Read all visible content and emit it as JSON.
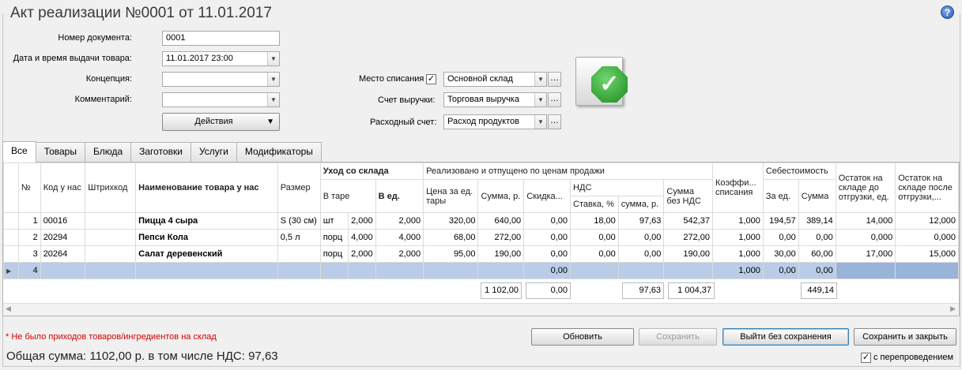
{
  "title": "Акт реализации №0001 от 11.01.2017",
  "form": {
    "doc_number_label": "Номер документа:",
    "doc_number": "0001",
    "date_label": "Дата и время выдачи товара:",
    "date": "11.01.2017 23:00",
    "concept_label": "Концепция:",
    "concept": "",
    "comment_label": "Комментарий:",
    "comment": "",
    "actions_label": "Действия",
    "writeoff_place_label": "Место списания",
    "writeoff_place": "Основной склад",
    "revenue_account_label": "Счет выручки:",
    "revenue_account": "Торговая выручка",
    "expense_account_label": "Расходный счет:",
    "expense_account": "Расход продуктов"
  },
  "tabs": [
    "Все",
    "Товары",
    "Блюда",
    "Заготовки",
    "Услуги",
    "Модификаторы"
  ],
  "table": {
    "headers": {
      "num": "№",
      "code": "Код у нас",
      "barcode": "Штрихкод",
      "name": "Наименование товара у нас",
      "size": "Размер",
      "out": "Уход со склада",
      "in_tare": "В таре",
      "in_units": "В ед.",
      "sold": "Реализовано и отпущено по ценам продажи",
      "price": "Цена за ед. тары",
      "amount": "Сумма, р.",
      "discount": "Скидка...",
      "vat": "НДС",
      "vat_rate": "Ставка, %",
      "vat_sum": "сумма, р.",
      "sum_no_vat": "Сумма без НДС",
      "coef": "Коэффи... списания",
      "cost": "Себестоимость",
      "cost_unit": "За ед.",
      "cost_sum": "Сумма",
      "stock_before": "Остаток на складе до отгрузки, ед.",
      "stock_after": "Остаток на складе после отгрузки,..."
    },
    "rows": [
      {
        "num": "1",
        "code": "00016",
        "barcode": "",
        "name": "Пицца 4 сыра",
        "size": "S (30 см)",
        "unit": "шт",
        "tare": "2,000",
        "units": "2,000",
        "price": "320,00",
        "amount": "640,00",
        "discount": "0,00",
        "vat_rate": "18,00",
        "vat_sum": "97,63",
        "sum_no_vat": "542,37",
        "coef": "1,000",
        "cost_unit": "194,57",
        "cost_sum": "389,14",
        "stock_before": "14,000",
        "stock_after": "12,000"
      },
      {
        "num": "2",
        "code": "20294",
        "barcode": "",
        "name": "Пепси Кола",
        "size": "0,5 л",
        "unit": "порц",
        "tare": "4,000",
        "units": "4,000",
        "price": "68,00",
        "amount": "272,00",
        "discount": "0,00",
        "vat_rate": "0,00",
        "vat_sum": "0,00",
        "sum_no_vat": "272,00",
        "coef": "1,000",
        "cost_unit": "0,00",
        "cost_sum": "0,00",
        "stock_before": "0,000",
        "stock_after": "0,000"
      },
      {
        "num": "3",
        "code": "20264",
        "barcode": "",
        "name": "Салат деревенский",
        "size": "",
        "unit": "порц",
        "tare": "2,000",
        "units": "2,000",
        "price": "95,00",
        "amount": "190,00",
        "discount": "0,00",
        "vat_rate": "0,00",
        "vat_sum": "0,00",
        "sum_no_vat": "190,00",
        "coef": "1,000",
        "cost_unit": "30,00",
        "cost_sum": "60,00",
        "stock_before": "17,000",
        "stock_after": "15,000"
      }
    ],
    "new_row": {
      "num": "4",
      "discount": "0,00",
      "coef": "1,000",
      "cost_unit": "0,00",
      "cost_sum": "0,00"
    },
    "totals": {
      "amount": "1 102,00",
      "discount": "0,00",
      "vat_sum": "97,63",
      "sum_no_vat": "1 004,37",
      "cost_sum": "449,14"
    }
  },
  "footer": {
    "error": "* Не было приходов товаров/ингредиентов на склад",
    "total": "Общая сумма: 1102,00 р. в том числе НДС: 97,63",
    "refresh": "Обновить",
    "save": "Сохранить",
    "exit": "Выйти без сохранения",
    "save_close": "Сохранить и закрыть",
    "repost": "с перепроведением"
  },
  "icons": {
    "help": "?",
    "ok": "✓"
  }
}
